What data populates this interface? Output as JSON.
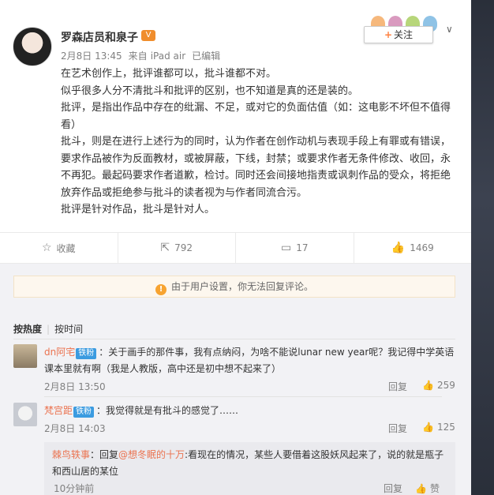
{
  "post": {
    "username": "罗森店员和泉子",
    "vip_badge": "V",
    "time": "2月8日 13:45",
    "source_prefix": "来自",
    "source": "iPad air",
    "edited": "已编辑",
    "follow_label": "关注",
    "paragraphs": [
      "在艺术创作上，批评谁都可以，批斗谁都不对。",
      "似乎很多人分不清批斗和批评的区别，也不知道是真的还是装的。",
      "批评，是指出作品中存在的纰漏、不足，或对它的负面估值（如：这电影不坏但不值得看）",
      "批斗，则是在进行上述行为的同时，认为作者在创作动机与表现手段上有罪或有错误，要求作品被作为反面教材，或被屏蔽，下线，封禁；或要求作者无条件修改、收回，永不再犯。最起码要求作者道歉，检讨。同时还会间接地指责或讽刺作品的受众，将拒绝放弃作品或拒绝参与批斗的读者视为与作者同流合污。",
      "批评是针对作品，批斗是针对人。"
    ]
  },
  "actions": {
    "favorite": "收藏",
    "repost": "792",
    "comment": "17",
    "like": "1469"
  },
  "notice": "由于用户设置，你无法回复评论。",
  "sort": {
    "hot": "按热度",
    "time": "按时间"
  },
  "comments": [
    {
      "name": "dn阿宅",
      "badge": "铁粉",
      "text": "：关于画手的那件事，我有点纳闷，为啥不能说lunar new year呢？我记得中学英语课本里就有啊（我是人教版，高中还是初中想不起来了）",
      "time": "2月8日 13:50",
      "reply": "回复",
      "likes": "259"
    },
    {
      "name": "梵宫距",
      "badge": "铁粉",
      "text": "：我觉得就是有批斗的感觉了……",
      "time": "2月8日 14:03",
      "reply": "回复",
      "likes": "125"
    }
  ],
  "sub_reply": {
    "name": "棘鸟轶事",
    "prefix": "：回复",
    "mention": "@想冬眠的十万",
    "text": ":看现在的情况，某些人要借着这股妖风起来了，说的就是瓶子和西山居的某位",
    "time": "10分钟前",
    "reply": "回复",
    "like": "赞"
  },
  "colors": {
    "accent": "#eb7350",
    "follow_plus": "#ff8140",
    "badge_blue": "#3b9be0"
  }
}
